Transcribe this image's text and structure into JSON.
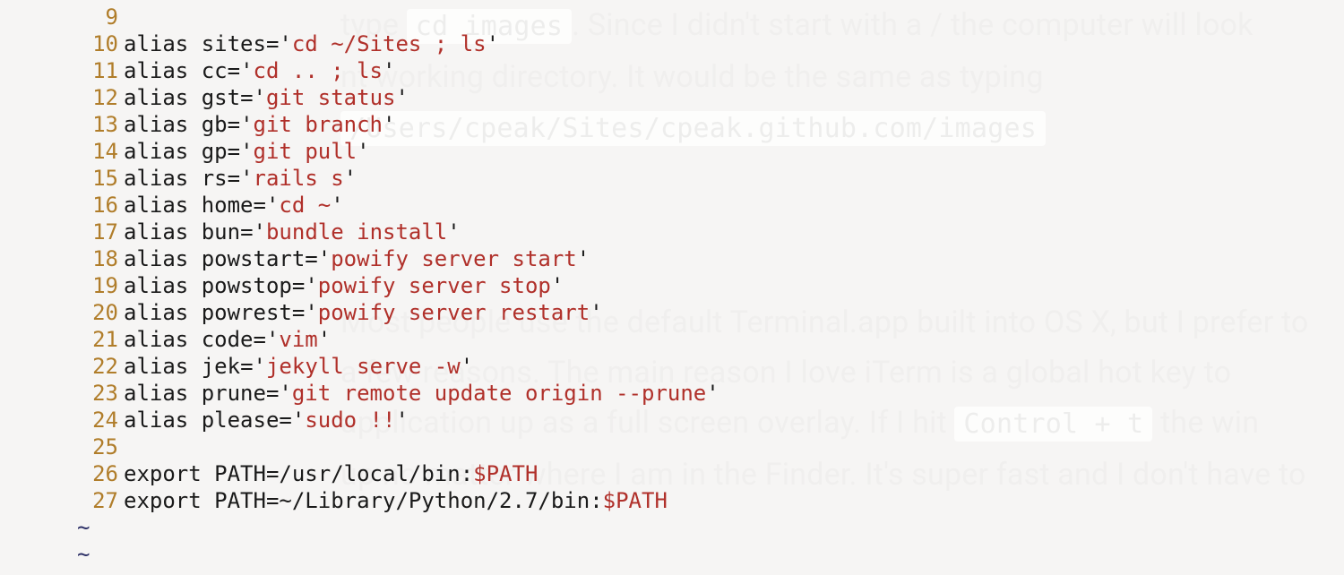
{
  "colors": {
    "gutter_stripe": "#2c2f66",
    "lineno": "#b07d2a",
    "string": "#b0302a",
    "fg": "#1a1a1a",
    "bg": "#f6f5f4"
  },
  "editor": {
    "first_visible_line": 9,
    "lines": [
      {
        "n": 9,
        "tokens": []
      },
      {
        "n": 10,
        "tokens": [
          {
            "t": "alias ",
            "c": "kw"
          },
          {
            "t": "sites",
            "c": "name"
          },
          {
            "t": "=",
            "c": "op"
          },
          {
            "t": "'",
            "c": "q"
          },
          {
            "t": "cd ~/Sites ; ls",
            "c": "str"
          },
          {
            "t": "'",
            "c": "q"
          }
        ]
      },
      {
        "n": 11,
        "tokens": [
          {
            "t": "alias ",
            "c": "kw"
          },
          {
            "t": "cc",
            "c": "name"
          },
          {
            "t": "=",
            "c": "op"
          },
          {
            "t": "'",
            "c": "q"
          },
          {
            "t": "cd .. ; ls",
            "c": "str"
          },
          {
            "t": "'",
            "c": "q"
          }
        ]
      },
      {
        "n": 12,
        "tokens": [
          {
            "t": "alias ",
            "c": "kw"
          },
          {
            "t": "gst",
            "c": "name"
          },
          {
            "t": "=",
            "c": "op"
          },
          {
            "t": "'",
            "c": "q"
          },
          {
            "t": "git status",
            "c": "str"
          },
          {
            "t": "'",
            "c": "q"
          }
        ]
      },
      {
        "n": 13,
        "tokens": [
          {
            "t": "alias ",
            "c": "kw"
          },
          {
            "t": "gb",
            "c": "name"
          },
          {
            "t": "=",
            "c": "op"
          },
          {
            "t": "'",
            "c": "q"
          },
          {
            "t": "git branch",
            "c": "str"
          },
          {
            "t": "'",
            "c": "q"
          }
        ]
      },
      {
        "n": 14,
        "tokens": [
          {
            "t": "alias ",
            "c": "kw"
          },
          {
            "t": "gp",
            "c": "name"
          },
          {
            "t": "=",
            "c": "op"
          },
          {
            "t": "'",
            "c": "q"
          },
          {
            "t": "git pull",
            "c": "str"
          },
          {
            "t": "'",
            "c": "q"
          }
        ]
      },
      {
        "n": 15,
        "tokens": [
          {
            "t": "alias ",
            "c": "kw"
          },
          {
            "t": "rs",
            "c": "name"
          },
          {
            "t": "=",
            "c": "op"
          },
          {
            "t": "'",
            "c": "q"
          },
          {
            "t": "rails s",
            "c": "str"
          },
          {
            "t": "'",
            "c": "q"
          }
        ]
      },
      {
        "n": 16,
        "tokens": [
          {
            "t": "alias ",
            "c": "kw"
          },
          {
            "t": "home",
            "c": "name"
          },
          {
            "t": "=",
            "c": "op"
          },
          {
            "t": "'",
            "c": "q"
          },
          {
            "t": "cd ~",
            "c": "str"
          },
          {
            "t": "'",
            "c": "q"
          }
        ]
      },
      {
        "n": 17,
        "tokens": [
          {
            "t": "alias ",
            "c": "kw"
          },
          {
            "t": "bun",
            "c": "name"
          },
          {
            "t": "=",
            "c": "op"
          },
          {
            "t": "'",
            "c": "q"
          },
          {
            "t": "bundle install",
            "c": "str"
          },
          {
            "t": "'",
            "c": "q"
          }
        ]
      },
      {
        "n": 18,
        "tokens": [
          {
            "t": "alias ",
            "c": "kw"
          },
          {
            "t": "powstart",
            "c": "name"
          },
          {
            "t": "=",
            "c": "op"
          },
          {
            "t": "'",
            "c": "q"
          },
          {
            "t": "powify server start",
            "c": "str"
          },
          {
            "t": "'",
            "c": "q"
          }
        ]
      },
      {
        "n": 19,
        "tokens": [
          {
            "t": "alias ",
            "c": "kw"
          },
          {
            "t": "powstop",
            "c": "name"
          },
          {
            "t": "=",
            "c": "op"
          },
          {
            "t": "'",
            "c": "q"
          },
          {
            "t": "powify server stop",
            "c": "str"
          },
          {
            "t": "'",
            "c": "q"
          }
        ]
      },
      {
        "n": 20,
        "tokens": [
          {
            "t": "alias ",
            "c": "kw"
          },
          {
            "t": "powrest",
            "c": "name"
          },
          {
            "t": "=",
            "c": "op"
          },
          {
            "t": "'",
            "c": "q"
          },
          {
            "t": "powify server restart",
            "c": "str"
          },
          {
            "t": "'",
            "c": "q"
          }
        ]
      },
      {
        "n": 21,
        "tokens": [
          {
            "t": "alias ",
            "c": "kw"
          },
          {
            "t": "code",
            "c": "name"
          },
          {
            "t": "=",
            "c": "op"
          },
          {
            "t": "'",
            "c": "q"
          },
          {
            "t": "vim",
            "c": "str"
          },
          {
            "t": "'",
            "c": "q"
          }
        ]
      },
      {
        "n": 22,
        "tokens": [
          {
            "t": "alias ",
            "c": "kw"
          },
          {
            "t": "jek",
            "c": "name"
          },
          {
            "t": "=",
            "c": "op"
          },
          {
            "t": "'",
            "c": "q"
          },
          {
            "t": "jekyll serve -w",
            "c": "str"
          },
          {
            "t": "'",
            "c": "q"
          }
        ]
      },
      {
        "n": 23,
        "tokens": [
          {
            "t": "alias ",
            "c": "kw"
          },
          {
            "t": "prune",
            "c": "name"
          },
          {
            "t": "=",
            "c": "op"
          },
          {
            "t": "'",
            "c": "q"
          },
          {
            "t": "git remote update origin --prune",
            "c": "str"
          },
          {
            "t": "'",
            "c": "q"
          }
        ]
      },
      {
        "n": 24,
        "tokens": [
          {
            "t": "alias ",
            "c": "kw"
          },
          {
            "t": "please",
            "c": "name"
          },
          {
            "t": "=",
            "c": "op"
          },
          {
            "t": "'",
            "c": "q"
          },
          {
            "t": "sudo !!",
            "c": "str"
          },
          {
            "t": "'",
            "c": "q"
          }
        ]
      },
      {
        "n": 25,
        "tokens": []
      },
      {
        "n": 26,
        "tokens": [
          {
            "t": "export ",
            "c": "kw"
          },
          {
            "t": "PATH",
            "c": "name"
          },
          {
            "t": "=",
            "c": "op"
          },
          {
            "t": "/usr/local/bin:",
            "c": "path"
          },
          {
            "t": "$PATH",
            "c": "var"
          }
        ]
      },
      {
        "n": 27,
        "tokens": [
          {
            "t": "export ",
            "c": "kw"
          },
          {
            "t": "PATH",
            "c": "name"
          },
          {
            "t": "=",
            "c": "op"
          },
          {
            "t": "~/Library/Python/2.7/bin:",
            "c": "path"
          },
          {
            "t": "$PATH",
            "c": "var"
          }
        ]
      }
    ],
    "trailing_tildes": 2,
    "tilde_char": "~"
  },
  "background_article": {
    "line1_prefix": "type ",
    "line1_kbd": "cd images",
    "line1_suffix": ". Since I didn't start with a / the computer will look",
    "line2": "                 nt working directory. It would be the same as typing",
    "line3_kbd": "/Users/cpeak/Sites/cpeak.github.com/images",
    "gap1": "",
    "line4": "Most people use the default Terminal.app built into OS X, but I prefer to",
    "line5_prefix": "a few reasons. The main reason I love iTerm is a global hot key to",
    "line6_prefix": "application up as a full screen overlay. If I hit ",
    "line6_kbd": "Control + t",
    "line6_suffix": " the win",
    "line7": "up no matter where I am in the Finder. It's super fast and I don't have to"
  }
}
